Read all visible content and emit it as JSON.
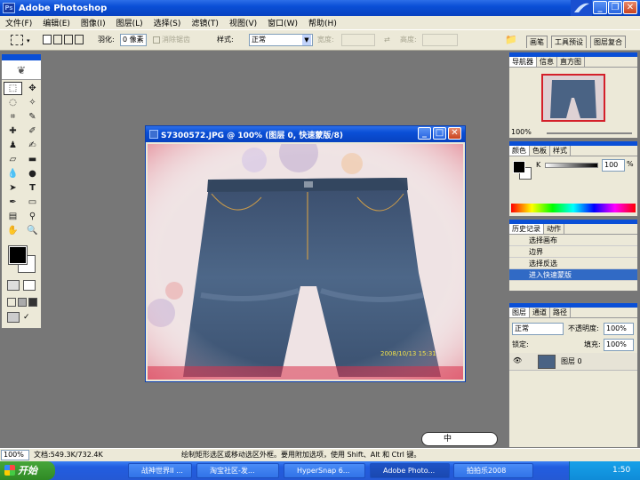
{
  "app": {
    "title": "Adobe Photoshop"
  },
  "menu": [
    "文件(F)",
    "编辑(E)",
    "图像(I)",
    "图层(L)",
    "选择(S)",
    "滤镜(T)",
    "视图(V)",
    "窗口(W)",
    "帮助(H)"
  ],
  "options": {
    "feather_label": "羽化:",
    "feather_value": "0 像素",
    "antialias_label": "消除锯齿",
    "style_label": "样式:",
    "style_value": "正常",
    "width_label": "宽度:",
    "height_label": "高度:"
  },
  "palette_well": [
    "画笔",
    "工具预设",
    "图层复合"
  ],
  "document": {
    "title": "S7300572.JPG @ 100% (图层 0, 快速蒙版/8)",
    "photo_timestamp": "2008/10/13 15:31"
  },
  "navigator": {
    "tabs": [
      "导航器",
      "信息",
      "直方图"
    ],
    "zoom": "100%"
  },
  "color_panel": {
    "tabs": [
      "颜色",
      "色板",
      "样式"
    ],
    "channel_label": "K",
    "value": "100",
    "unit": "%",
    "accent": "#0a4fd6"
  },
  "history": {
    "tabs": [
      "历史记录",
      "动作"
    ],
    "items": [
      "选择画布",
      "边界",
      "选择反选",
      "进入快速蒙版"
    ],
    "active_index": 3
  },
  "layers": {
    "tabs": [
      "图层",
      "通道",
      "路径"
    ],
    "blend_mode": "正常",
    "opacity_label": "不透明度:",
    "opacity_value": "100%",
    "lock_label": "锁定:",
    "fill_label": "填充:",
    "fill_value": "100%",
    "layer_name": "图层 0"
  },
  "status": {
    "zoom": "100%",
    "doc_info": "文档:549.3K/732.4K",
    "hint": "绘制矩形选区或移动选区外框。要用附加选项，使用 Shift、Alt 和 Ctrl 键。"
  },
  "taskbar": {
    "start": "开始",
    "tasks": [
      "战神世界II ...",
      "淘宝社区-发...",
      "HyperSnap 6...",
      "Adobe Photo...",
      "拍拍乐2008"
    ],
    "ime": "中",
    "clock": "1:50"
  }
}
